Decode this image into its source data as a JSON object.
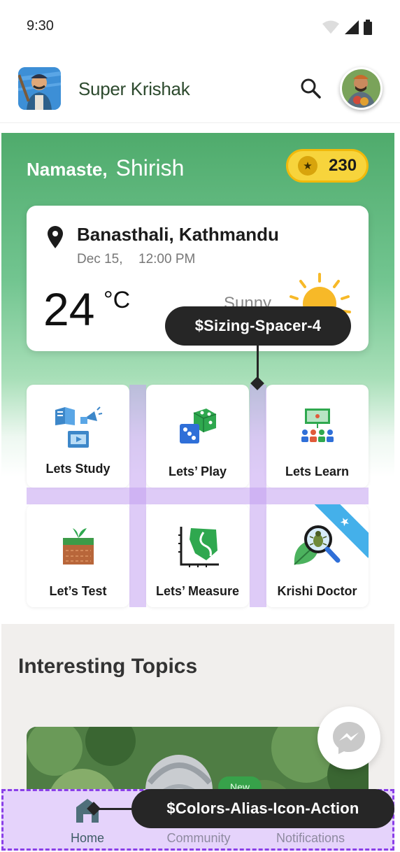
{
  "status_bar": {
    "time": "9:30"
  },
  "app_bar": {
    "title": "Super Krishak"
  },
  "greeting": {
    "hello": "Namaste,",
    "name": "Shirish"
  },
  "coins": {
    "count": "230"
  },
  "weather": {
    "location": "Banasthali, Kathmandu",
    "date": "Dec 15,",
    "time": "12:00 PM",
    "temperature": "24",
    "unit": "°C",
    "condition": "Sunny"
  },
  "tiles": [
    {
      "label": "Lets Study"
    },
    {
      "label": "Lets’ Play"
    },
    {
      "label": "Lets Learn"
    },
    {
      "label": "Let’s Test"
    },
    {
      "label": "Lets’ Measure"
    },
    {
      "label": "Krishi Doctor"
    }
  ],
  "topics": {
    "title": "Interesting Topics",
    "badge": "New"
  },
  "bottom_nav": {
    "home": "Home",
    "community": "Community",
    "notifications": "Notifications"
  },
  "annotations": {
    "spacer": "$Sizing-Spacer-4",
    "icon_action": "$Colors-Alias-Icon-Action"
  },
  "colors": {
    "brand_green": "#4fab6c",
    "coin_yellow": "#f7d43c",
    "spacer_overlay": "#c3a0f0",
    "annotation_dashed": "#8a3fe8"
  }
}
